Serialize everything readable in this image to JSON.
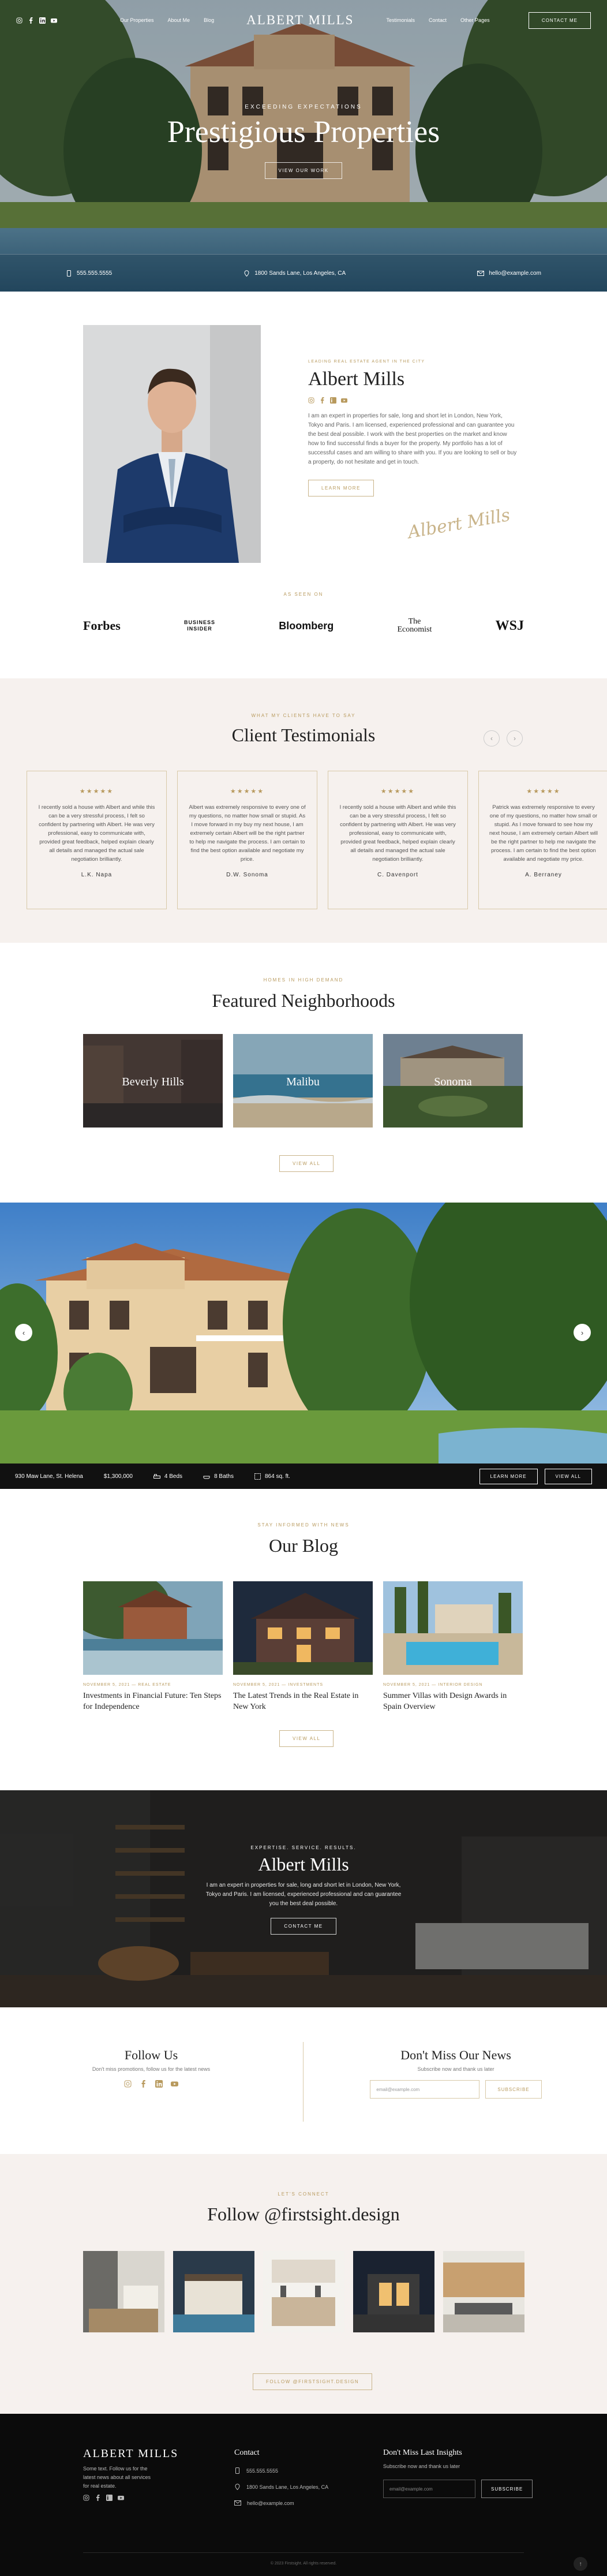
{
  "nav": {
    "links_left": [
      "Our Properties",
      "About Me",
      "Blog"
    ],
    "logo": "ALBERT MILLS",
    "links_right": [
      "Testimonials",
      "Contact",
      "Other Pages"
    ],
    "cta": "CONTACT ME",
    "social_icons": [
      "instagram-icon",
      "facebook-icon",
      "linkedin-icon",
      "youtube-icon"
    ]
  },
  "hero": {
    "eyebrow": "EXCEEDING EXPECTATIONS",
    "title": "Prestigious Properties",
    "button": "VIEW OUR WORK",
    "phone": "555.555.5555",
    "address": "1800 Sands Lane, Los Angeles, CA",
    "email": "hello@example.com"
  },
  "about": {
    "eyebrow": "LEADING REAL ESTATE AGENT IN THE CITY",
    "name": "Albert Mills",
    "bio": "I am an expert in properties for sale, long and short let in London, New York, Tokyo and Paris. I am licensed, experienced professional and can guarantee you the best deal possible. I work with the best properties on the market and know how to find successful finds a buyer for the property. My portfolio has a lot of successful cases and am willing to share with you. If you are looking to sell or buy a property, do not hesitate and get in touch.",
    "button": "LEARN MORE",
    "signature": "Albert Mills"
  },
  "seen": {
    "eyebrow": "AS SEEN ON",
    "logos": {
      "forbes": "Forbes",
      "bi1": "BUSINESS",
      "bi2": "INSIDER",
      "bloomberg": "Bloomberg",
      "eco1": "The",
      "eco2": "Economist",
      "wsj": "WSJ"
    }
  },
  "testimonials": {
    "eyebrow": "WHAT MY CLIENTS HAVE TO SAY",
    "title": "Client Testimonials",
    "items": [
      {
        "stars": "★★★★★",
        "text": "I recently sold a house with Albert and while this can be a very stressful process, I felt so confident by partnering with Albert. He was very professional, easy to communicate with, provided great feedback, helped explain clearly all details and managed the actual sale negotiation brilliantly.",
        "name": "L.K. Napa"
      },
      {
        "stars": "★★★★★",
        "text": "Albert was extremely responsive to every one of my questions, no matter how small or stupid. As I move forward in my buy my next house, I am extremely certain Albert will be the right partner to help me navigate the process. I am certain to find the best option available and negotiate my price.",
        "name": "D.W. Sonoma"
      },
      {
        "stars": "★★★★★",
        "text": "I recently sold a house with Albert and while this can be a very stressful process, I felt so confident by partnering with Albert. He was very professional, easy to communicate with, provided great feedback, helped explain clearly all details and managed the actual sale negotiation brilliantly.",
        "name": "C. Davenport"
      },
      {
        "stars": "★★★★★",
        "text": "Patrick was extremely responsive to every one of my questions, no matter how small or stupid. As I move forward to see how my next house, I am extremely certain Albert will be the right partner to help me navigate the process. I am certain to find the best option available and negotiate my price.",
        "name": "A. Berraney"
      }
    ]
  },
  "neighborhoods": {
    "eyebrow": "HOMES IN HIGH DEMAND",
    "title": "Featured Neighborhoods",
    "items": [
      "Beverly Hills",
      "Malibu",
      "Sonoma"
    ],
    "button": "VIEW ALL"
  },
  "property": {
    "address": "930 Maw Lane, St. Helena",
    "price": "$1,300,000",
    "beds": "4 Beds",
    "baths": "8 Baths",
    "area": "864 sq. ft.",
    "learn": "LEARN MORE",
    "view": "VIEW ALL"
  },
  "blog": {
    "eyebrow": "STAY INFORMED WITH NEWS",
    "title": "Our Blog",
    "posts": [
      {
        "meta": "NOVEMBER 5, 2021 — REAL ESTATE",
        "title": "Investments in Financial Future: Ten Steps for Independence"
      },
      {
        "meta": "NOVEMBER 5, 2021 — INVESTMENTS",
        "title": "The Latest Trends in the Real Estate in New York"
      },
      {
        "meta": "NOVEMBER 5, 2021 — INTERIOR DESIGN",
        "title": "Summer Villas with Design Awards in Spain Overview"
      }
    ],
    "button": "VIEW ALL"
  },
  "banner": {
    "eyebrow": "EXPERTISE. SERVICE. RESULTS.",
    "title": "Albert Mills",
    "text": "I am an expert in properties for sale, long and short let in London, New York, Tokyo and Paris. I am licensed, experienced professional and can guarantee you the best deal possible.",
    "button": "CONTACT ME"
  },
  "follow": {
    "title": "Follow Us",
    "sub": "Don't miss promotions, follow us for the latest news"
  },
  "news": {
    "title": "Don't Miss Our News",
    "sub": "Subscribe now and thank us later",
    "placeholder": "email@example.com",
    "button": "SUBSCRIBE"
  },
  "instagram": {
    "eyebrow": "LET'S CONNECT",
    "title": "Follow @firstsight.design",
    "button": "FOLLOW @FIRSTSIGHT.DESIGN"
  },
  "footer": {
    "logo": "ALBERT MILLS",
    "tagline": "Some text. Follow us for the latest news about all services for real estate.",
    "contact_title": "Contact",
    "phone": "555.555.5555",
    "address": "1800 Sands Lane, Los Angeles, CA",
    "email": "hello@example.com",
    "news_title": "Don't Miss Last Insights",
    "news_sub": "Subscribe now and thank us later",
    "placeholder": "email@example.com",
    "button": "SUBSCRIBE",
    "copyright": "© 2023 Firstsight. All rights reserved."
  }
}
